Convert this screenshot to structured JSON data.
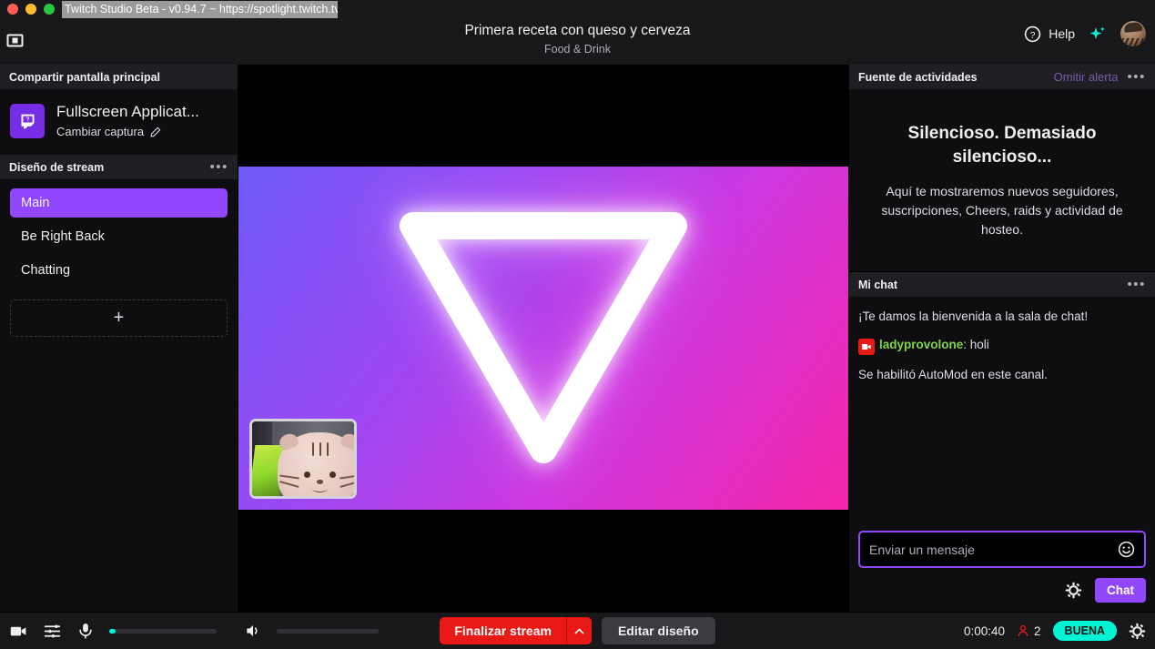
{
  "window": {
    "title": "Twitch Studio Beta - v0.94.7 ~ https://spotlight.twitch.tv"
  },
  "header": {
    "stream_title": "Primera receta con queso y cerveza",
    "category": "Food & Drink",
    "help_label": "Help",
    "help_icon": "question-circle-icon",
    "sparkle_icon": "sparkle-icon",
    "avatar_icon": "user-avatar",
    "panel_toggle_icon": "layout-panel-icon"
  },
  "sidebar": {
    "screenshare_header": "Compartir pantalla principal",
    "capture": {
      "title": "Fullscreen Applicat...",
      "change_label": "Cambiar captura",
      "edit_icon": "pencil-icon",
      "app_icon": "twitch-glitch-icon"
    },
    "layout_header": "Diseño de stream",
    "layout_menu_icon": "ellipsis-icon",
    "scenes": [
      {
        "label": "Main",
        "active": true
      },
      {
        "label": "Be Right Back",
        "active": false
      },
      {
        "label": "Chatting",
        "active": false
      }
    ],
    "add_scene_label": "+"
  },
  "preview": {
    "gradient_start": "#6f5cf7",
    "gradient_mid": "#cf36dd",
    "gradient_end": "#f526a8",
    "overlay_shape": "glowing-triangle-outline",
    "webcam_source": "webcam-thumbnail"
  },
  "activity": {
    "header": "Fuente de actividades",
    "skip_alert": "Omitir alerta",
    "menu_icon": "ellipsis-icon",
    "empty_title": "Silencioso. Demasiado silencioso...",
    "empty_body": "Aquí te mostraremos nuevos seguidores, suscripciones, Cheers, raids y actividad de hosteo."
  },
  "chat": {
    "header": "Mi chat",
    "menu_icon": "ellipsis-icon",
    "messages": [
      {
        "type": "system",
        "text": "¡Te damos la bienvenida a la sala de chat!"
      },
      {
        "type": "user",
        "badge": "broadcaster-camera-badge",
        "user": "ladypro volone",
        "username": "ladyprovolone",
        "separator": ": ",
        "text": "holi",
        "user_color": "#7fd44a"
      },
      {
        "type": "system",
        "text": "Se habilitó AutoMod en este canal."
      }
    ],
    "input_placeholder": "Enviar un mensaje",
    "emote_icon": "smiley-icon",
    "settings_icon": "gear-icon",
    "send_label": "Chat"
  },
  "bottombar": {
    "camera_icon": "video-camera-icon",
    "mixer_icon": "audio-mixer-icon",
    "mic_icon": "microphone-icon",
    "mic_level_color": "#00f5d4",
    "speaker_icon": "speaker-icon",
    "end_stream_label": "Finalizar stream",
    "end_stream_caret_icon": "chevron-up-icon",
    "edit_layout_label": "Editar diseño",
    "timer": "0:00:40",
    "viewer_icon": "viewer-person-icon",
    "viewer_count": "2",
    "quality_label": "BUENA",
    "quality_color": "#00f5d4",
    "settings_icon": "gear-icon"
  }
}
